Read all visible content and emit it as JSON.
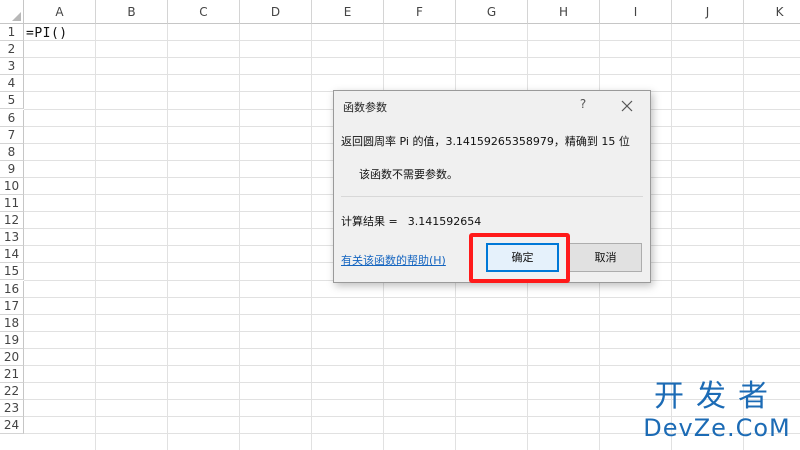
{
  "sheet": {
    "columns": [
      "A",
      "B",
      "C",
      "D",
      "E",
      "F",
      "G",
      "H",
      "I",
      "J",
      "K"
    ],
    "rows": [
      "1",
      "2",
      "3",
      "4",
      "5",
      "6",
      "7",
      "8",
      "9",
      "10",
      "11",
      "12",
      "13",
      "14",
      "15",
      "16",
      "17",
      "18",
      "19",
      "20",
      "21",
      "22",
      "23",
      "24"
    ],
    "cell_a1": "=PI()"
  },
  "dialog": {
    "title": "函数参数",
    "help_symbol": "?",
    "description": "返回圆周率 Pi 的值，3.14159265358979，精确到 15 位",
    "no_args_note": "该函数不需要参数。",
    "result_label": "计算结果 =",
    "result_value": "3.141592654",
    "help_link": "有关该函数的帮助(H)",
    "ok_label": "确定",
    "cancel_label": "取消"
  },
  "annotation": {
    "highlight_color": "#ff1a1a"
  },
  "watermark": {
    "line1": "开发者",
    "line2": "DevZe.CoM"
  }
}
